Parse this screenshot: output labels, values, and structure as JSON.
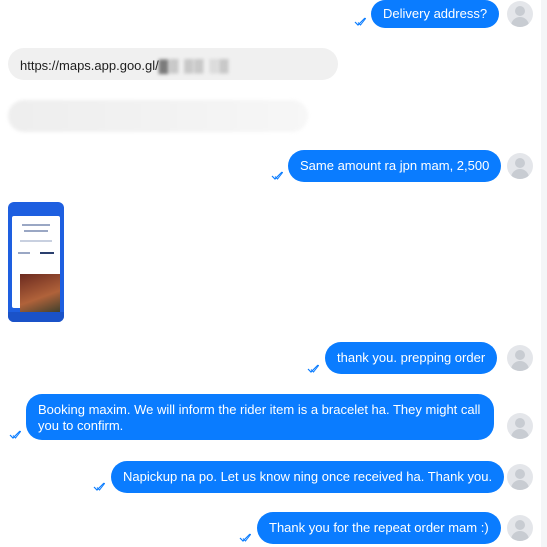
{
  "messages": {
    "delivery_address": "Delivery address?",
    "maps_link": "https://maps.app.goo.gl/",
    "same_amount": "Same amount ra jpn mam, 2,500",
    "thank_you_prepping": "thank you. prepping order",
    "booking_maxim": "Booking maxim. We will inform the rider item is a bracelet ha. They might call you to confirm.",
    "napickup": "Napickup na po. Let us know ning once received ha. Thank you.",
    "repeat_order": "Thank you for the repeat order mam :)"
  },
  "colors": {
    "outgoing_bubble": "#0a7cff",
    "incoming_bubble": "#f0f0f0",
    "seen_check": "#0a7cff"
  },
  "icons": {
    "seen": "double-check-icon",
    "avatar": "default-avatar-icon"
  }
}
